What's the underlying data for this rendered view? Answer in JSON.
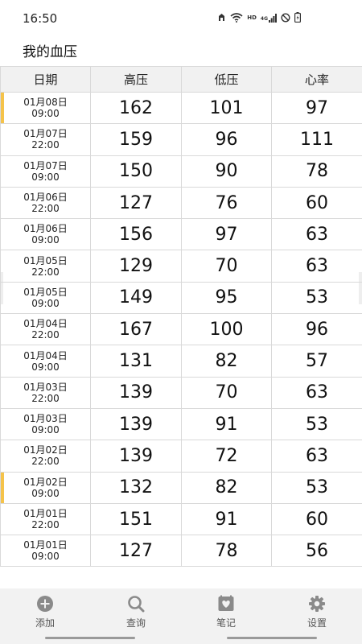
{
  "status_bar": {
    "time": "16:50",
    "icons": [
      "silent-mode-icon",
      "wifi-icon",
      "hd-icon",
      "signal-icon",
      "do-not-disturb-icon",
      "battery-icon"
    ],
    "hd_label": "HD",
    "network_label": "4G"
  },
  "header": {
    "title": "我的血压"
  },
  "table": {
    "columns": [
      "日期",
      "高压",
      "低压",
      "心率"
    ],
    "rows": [
      {
        "date": "01月08日",
        "time": "09:00",
        "systolic": "162",
        "diastolic": "101",
        "heart_rate": "97",
        "marked": true
      },
      {
        "date": "01月07日",
        "time": "22:00",
        "systolic": "159",
        "diastolic": "96",
        "heart_rate": "111",
        "marked": false
      },
      {
        "date": "01月07日",
        "time": "09:00",
        "systolic": "150",
        "diastolic": "90",
        "heart_rate": "78",
        "marked": false
      },
      {
        "date": "01月06日",
        "time": "22:00",
        "systolic": "127",
        "diastolic": "76",
        "heart_rate": "60",
        "marked": false
      },
      {
        "date": "01月06日",
        "time": "09:00",
        "systolic": "156",
        "diastolic": "97",
        "heart_rate": "63",
        "marked": false
      },
      {
        "date": "01月05日",
        "time": "22:00",
        "systolic": "129",
        "diastolic": "70",
        "heart_rate": "63",
        "marked": false
      },
      {
        "date": "01月05日",
        "time": "09:00",
        "systolic": "149",
        "diastolic": "95",
        "heart_rate": "53",
        "marked": false
      },
      {
        "date": "01月04日",
        "time": "22:00",
        "systolic": "167",
        "diastolic": "100",
        "heart_rate": "96",
        "marked": false
      },
      {
        "date": "01月04日",
        "time": "09:00",
        "systolic": "131",
        "diastolic": "82",
        "heart_rate": "57",
        "marked": false
      },
      {
        "date": "01月03日",
        "time": "22:00",
        "systolic": "139",
        "diastolic": "70",
        "heart_rate": "63",
        "marked": false
      },
      {
        "date": "01月03日",
        "time": "09:00",
        "systolic": "139",
        "diastolic": "91",
        "heart_rate": "53",
        "marked": false
      },
      {
        "date": "01月02日",
        "time": "22:00",
        "systolic": "139",
        "diastolic": "72",
        "heart_rate": "63",
        "marked": false
      },
      {
        "date": "01月02日",
        "time": "09:00",
        "systolic": "132",
        "diastolic": "82",
        "heart_rate": "53",
        "marked": true
      },
      {
        "date": "01月01日",
        "time": "22:00",
        "systolic": "151",
        "diastolic": "91",
        "heart_rate": "60",
        "marked": false
      },
      {
        "date": "01月01日",
        "time": "09:00",
        "systolic": "127",
        "diastolic": "78",
        "heart_rate": "56",
        "marked": false
      }
    ]
  },
  "bottom_nav": {
    "items": [
      {
        "key": "add",
        "label": "添加",
        "icon": "add-circle-icon"
      },
      {
        "key": "search",
        "label": "查询",
        "icon": "search-icon"
      },
      {
        "key": "notes",
        "label": "笔记",
        "icon": "note-heart-icon"
      },
      {
        "key": "settings",
        "label": "设置",
        "icon": "gear-icon"
      }
    ]
  },
  "colors": {
    "marker": "#f5c34a",
    "header_bg": "#f1f1f1",
    "grid": "#d9d9d9",
    "nav_bg": "#f2f2f2",
    "nav_icon": "#8a8a8a"
  }
}
